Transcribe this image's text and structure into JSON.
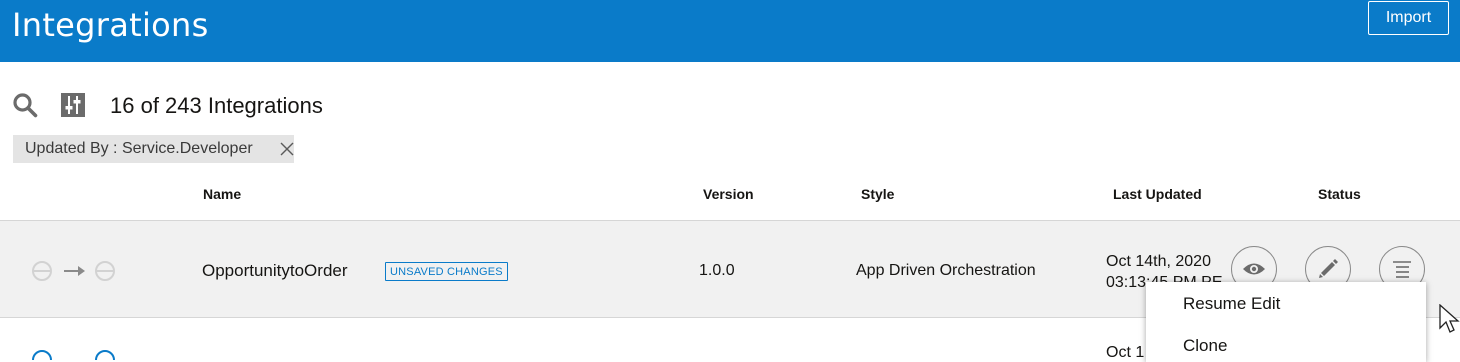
{
  "header": {
    "title": "Integrations",
    "import_label": "Import"
  },
  "toolbar": {
    "count_text": "16 of 243 Integrations"
  },
  "filter_chip": {
    "label": "Updated By : Service.Developer"
  },
  "columns": {
    "name": "Name",
    "version": "Version",
    "style": "Style",
    "last_updated": "Last Updated",
    "status": "Status"
  },
  "rows": [
    {
      "name": "OpportunitytoOrder",
      "badge": "UNSAVED CHANGES",
      "version": "1.0.0",
      "style": "App Driven Orchestration",
      "date": "Oct 14th, 2020",
      "time": "03:13:45 PM PE"
    },
    {
      "date": "Oct 1"
    }
  ],
  "action_menu": {
    "items": [
      "Resume Edit",
      "Clone"
    ]
  },
  "colors": {
    "header_bg": "#0a7bc9",
    "row_bg": "#f1f1f1",
    "chip_bg": "#e4e4e4",
    "accent": "#0a7bc9"
  },
  "icons": [
    "search-icon",
    "filter-icon",
    "close-icon",
    "integration-pattern-icon",
    "view-icon",
    "edit-icon",
    "menu-icon",
    "cursor-icon"
  ]
}
